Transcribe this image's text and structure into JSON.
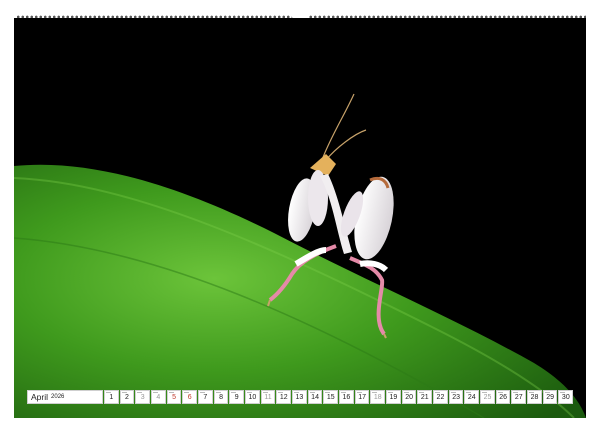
{
  "calendar": {
    "month": "April",
    "year": "2026",
    "days": [
      {
        "num": "1",
        "type": "normal"
      },
      {
        "num": "2",
        "type": "normal"
      },
      {
        "num": "3",
        "type": "holiday"
      },
      {
        "num": "4",
        "type": "holiday"
      },
      {
        "num": "5",
        "type": "weekend"
      },
      {
        "num": "6",
        "type": "weekend"
      },
      {
        "num": "7",
        "type": "normal"
      },
      {
        "num": "8",
        "type": "normal"
      },
      {
        "num": "9",
        "type": "normal"
      },
      {
        "num": "10",
        "type": "normal"
      },
      {
        "num": "11",
        "type": "holiday"
      },
      {
        "num": "12",
        "type": "normal"
      },
      {
        "num": "13",
        "type": "normal"
      },
      {
        "num": "14",
        "type": "normal"
      },
      {
        "num": "15",
        "type": "normal"
      },
      {
        "num": "16",
        "type": "normal"
      },
      {
        "num": "17",
        "type": "normal"
      },
      {
        "num": "18",
        "type": "holiday"
      },
      {
        "num": "19",
        "type": "normal"
      },
      {
        "num": "20",
        "type": "normal"
      },
      {
        "num": "21",
        "type": "normal"
      },
      {
        "num": "22",
        "type": "normal"
      },
      {
        "num": "23",
        "type": "normal"
      },
      {
        "num": "24",
        "type": "normal"
      },
      {
        "num": "25",
        "type": "holiday"
      },
      {
        "num": "26",
        "type": "normal"
      },
      {
        "num": "27",
        "type": "normal"
      },
      {
        "num": "28",
        "type": "normal"
      },
      {
        "num": "29",
        "type": "normal"
      },
      {
        "num": "30",
        "type": "normal"
      }
    ]
  },
  "photo": {
    "subject": "orchid-mantis-on-leaf-icon",
    "colors": {
      "background": "#000000",
      "leaf_dark": "#1f6b12",
      "leaf_light": "#5cb82a",
      "mantis_body": "#f1eef0",
      "mantis_pink": "#e58aa8"
    }
  }
}
